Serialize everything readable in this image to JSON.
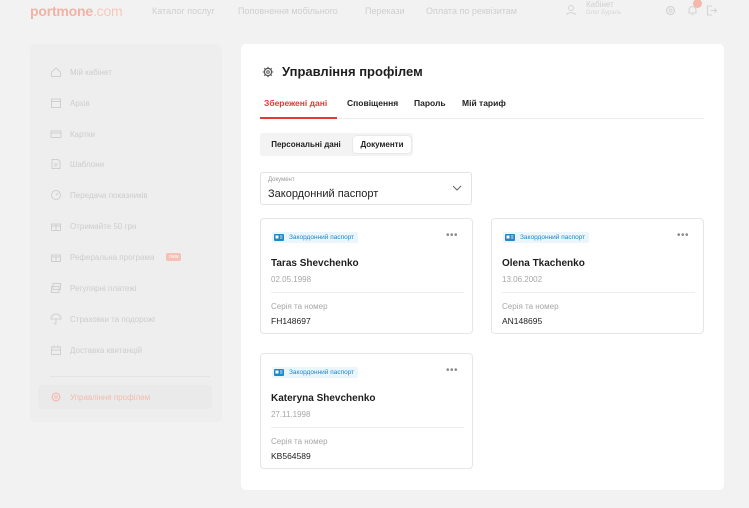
{
  "header": {
    "logo_main": "portmone",
    "logo_suffix": ".com",
    "nav": [
      "Каталог послуг",
      "Поповнення мобільного",
      "Перекази",
      "Оплата по реквізитам"
    ],
    "account_title": "Кабінет",
    "account_sub": "Олег Бураль"
  },
  "sidebar": {
    "items": [
      {
        "label": "Мій кабінет",
        "icon": "home-icon"
      },
      {
        "label": "Архів",
        "icon": "archive-icon"
      },
      {
        "label": "Картки",
        "icon": "card-icon"
      },
      {
        "label": "Шаблони",
        "icon": "template-icon"
      },
      {
        "label": "Передача показників",
        "icon": "meter-icon"
      },
      {
        "label": "Отримайте 50 грн",
        "icon": "gift-icon"
      },
      {
        "label": "Реферальна програма",
        "icon": "referral-icon",
        "badge": "new"
      },
      {
        "label": "Регулярні платежі",
        "icon": "recurring-icon"
      },
      {
        "label": "Страховки та подорожі",
        "icon": "umbrella-icon"
      },
      {
        "label": "Доставка квитанцій",
        "icon": "delivery-icon"
      }
    ],
    "active": {
      "label": "Управління профілем",
      "icon": "gear-icon"
    }
  },
  "main": {
    "title": "Управління профілем",
    "tabs": [
      {
        "label": "Збережені дані",
        "active": true
      },
      {
        "label": "Сповіщення",
        "active": false
      },
      {
        "label": "Пароль",
        "active": false
      },
      {
        "label": "Мій тариф",
        "active": false
      }
    ],
    "subtabs": [
      {
        "label": "Персональні дані",
        "active": false
      },
      {
        "label": "Документи",
        "active": true
      }
    ],
    "document_select": {
      "label": "Документ",
      "value": "Закордонний паспорт"
    },
    "documents": [
      {
        "type": "Закордонний паспорт",
        "name": "Taras Shevchenko",
        "date": "02.05.1998",
        "series_label": "Серія та номер",
        "series": "FH148697"
      },
      {
        "type": "Закордонний паспорт",
        "name": "Olena Tkachenko",
        "date": "13.06.2002",
        "series_label": "Серія та номер",
        "series": "AN148695"
      },
      {
        "type": "Закордонний паспорт",
        "name": "Kateryna Shevchenko",
        "date": "27.11.1998",
        "series_label": "Серія та номер",
        "series": "KB564589"
      }
    ],
    "more_label": "•••"
  },
  "colors": {
    "accent": "#e53935",
    "doc_tag": "#1e88c9",
    "page_bg": "#f2f2f2"
  }
}
